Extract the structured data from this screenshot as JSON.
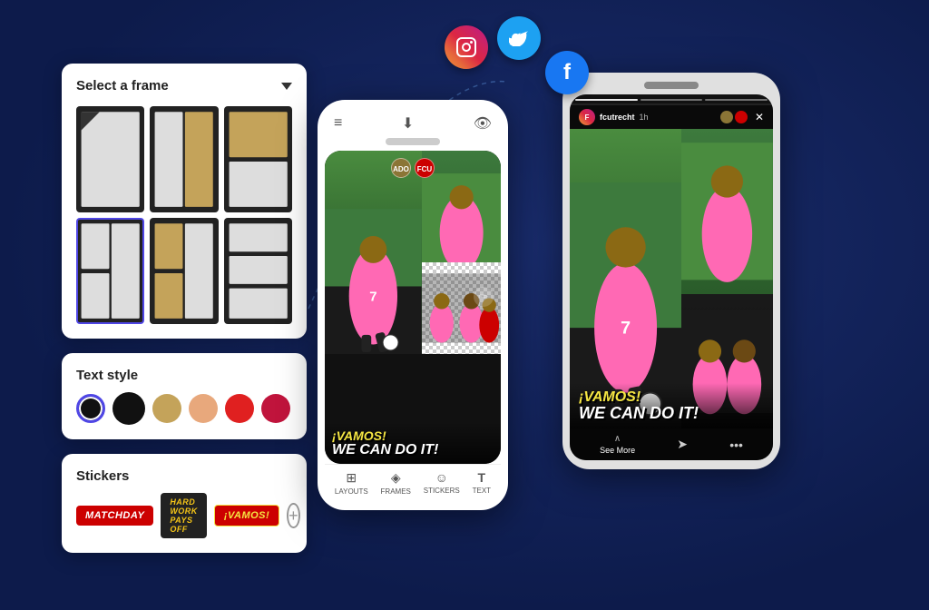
{
  "background": "#0d1b4b",
  "social": {
    "instagram": {
      "label": "IG",
      "symbol": "📷",
      "color": "#e1306c"
    },
    "twitter": {
      "label": "Tw",
      "symbol": "🐦",
      "color": "#1da1f2"
    },
    "facebook": {
      "label": "f",
      "color": "#1877f2"
    }
  },
  "left_panel": {
    "frame_selector": {
      "title": "Select a frame",
      "dropdown_hint": "▼"
    },
    "text_style": {
      "title": "Text style",
      "colors": [
        "#111111",
        "#c4a35a",
        "#e8a87c",
        "#e02020",
        "#c0143c"
      ]
    },
    "stickers": {
      "title": "Stickers",
      "items": [
        "MATCHDAY",
        "HARD WORK PAYS OFF",
        "¡VAMOS!"
      ],
      "add_label": "+"
    }
  },
  "editor_phone": {
    "toolbar_top": [
      "≡",
      "⬇",
      "👁"
    ],
    "toolbar_bottom": [
      {
        "icon": "⊞",
        "label": "LAYOUTS"
      },
      {
        "icon": "◈",
        "label": "FRAMES"
      },
      {
        "icon": "☺",
        "label": "STICKERS"
      },
      {
        "icon": "T",
        "label": "TEXT"
      }
    ],
    "overlay_text1": "¡VAMOS!",
    "overlay_text2": "WE CAN DO IT!"
  },
  "preview_phone": {
    "status_user": "fcutrecht",
    "status_time": "1h",
    "overlay_text1": "¡VAMOS!",
    "overlay_text2": "WE CAN DO IT!",
    "see_more": "See More",
    "progress_segments": 3
  },
  "colors": {
    "accent_purple": "#4f46e5",
    "pink_jersey": "#ff69b4",
    "grass_green": "#4a8c3f",
    "dark_bg": "#1a1a1a",
    "gold": "#c4a35a",
    "vamos_yellow": "#f5e642",
    "red": "#cc0000"
  }
}
